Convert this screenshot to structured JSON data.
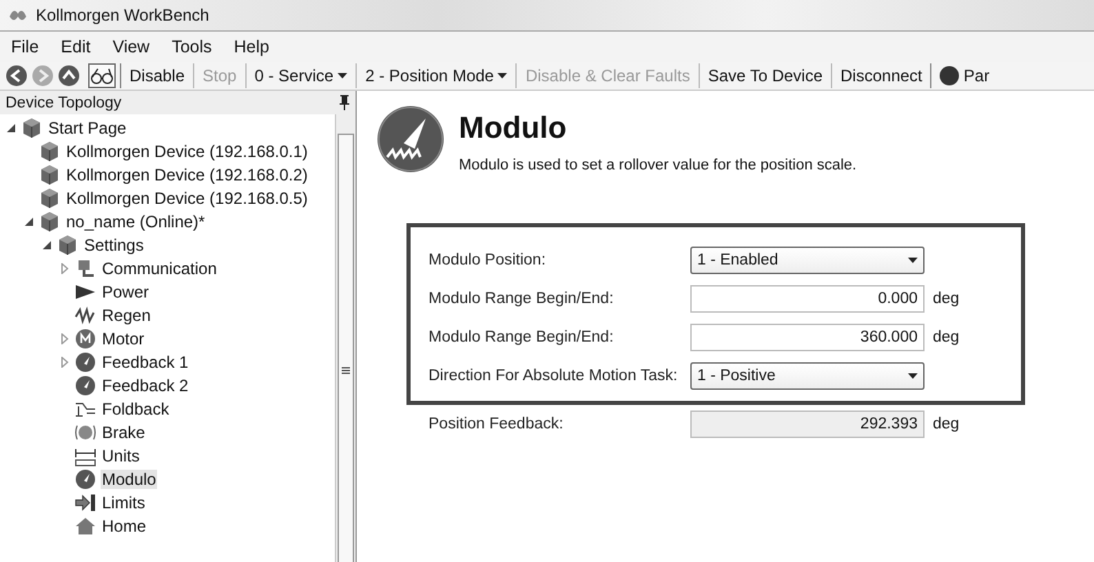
{
  "window": {
    "title": "Kollmorgen WorkBench"
  },
  "menu": [
    "File",
    "Edit",
    "View",
    "Tools",
    "Help"
  ],
  "toolbar": [
    {
      "kind": "button",
      "label": "Disable",
      "disabled": false
    },
    {
      "kind": "button",
      "label": "Stop",
      "disabled": true
    },
    {
      "kind": "dropdown",
      "label": "0 - Service",
      "disabled": false
    },
    {
      "kind": "dropdown",
      "label": "2 - Position Mode",
      "disabled": false
    },
    {
      "kind": "button",
      "label": "Disable & Clear Faults",
      "disabled": true
    },
    {
      "kind": "button",
      "label": "Save To Device",
      "disabled": false
    },
    {
      "kind": "button",
      "label": "Disconnect",
      "disabled": false
    },
    {
      "kind": "status",
      "label": "Par",
      "disabled": false
    }
  ],
  "sidebar": {
    "title": "Device Topology",
    "items": [
      {
        "label": "Start Page",
        "kind": "start",
        "expanded": true,
        "selected": false,
        "children": [
          {
            "label": "Kollmorgen Device (192.168.0.1)",
            "kind": "device",
            "selected": false
          },
          {
            "label": "Kollmorgen Device (192.168.0.2)",
            "kind": "device",
            "selected": false
          },
          {
            "label": "Kollmorgen Device (192.168.0.5)",
            "kind": "device",
            "selected": false
          },
          {
            "label": "no_name (Online)*",
            "kind": "device",
            "expanded": true,
            "selected": false,
            "children": [
              {
                "label": "Settings",
                "kind": "settings",
                "expanded": true,
                "selected": false,
                "children": [
                  {
                    "label": "Communication",
                    "kind": "communication",
                    "expanded": false,
                    "selected": false
                  },
                  {
                    "label": "Power",
                    "kind": "power",
                    "selected": false
                  },
                  {
                    "label": "Regen",
                    "kind": "regen",
                    "selected": false
                  },
                  {
                    "label": "Motor",
                    "kind": "motor",
                    "expanded": false,
                    "selected": false
                  },
                  {
                    "label": "Feedback 1",
                    "kind": "feedback",
                    "expanded": false,
                    "selected": false
                  },
                  {
                    "label": "Feedback 2",
                    "kind": "feedback",
                    "selected": false
                  },
                  {
                    "label": "Foldback",
                    "kind": "foldback",
                    "selected": false
                  },
                  {
                    "label": "Brake",
                    "kind": "brake",
                    "selected": false
                  },
                  {
                    "label": "Units",
                    "kind": "units",
                    "selected": false
                  },
                  {
                    "label": "Modulo",
                    "kind": "modulo",
                    "selected": true
                  },
                  {
                    "label": "Limits",
                    "kind": "limits",
                    "selected": false
                  },
                  {
                    "label": "Home",
                    "kind": "home",
                    "selected": false
                  }
                ]
              }
            ]
          }
        ]
      }
    ]
  },
  "page": {
    "title": "Modulo",
    "description": "Modulo is used to set a rollover value for the position scale.",
    "highlighted_fields": [
      {
        "kind": "select",
        "label": "Modulo Position:",
        "value": "1 - Enabled"
      },
      {
        "kind": "number",
        "label": "Modulo Range Begin/End:",
        "value": "0.000",
        "unit": "deg"
      },
      {
        "kind": "number",
        "label": "Modulo Range Begin/End:",
        "value": "360.000",
        "unit": "deg"
      },
      {
        "kind": "select",
        "label": "Direction For Absolute Motion Task:",
        "value": "1 - Positive"
      }
    ],
    "other_fields": [
      {
        "kind": "readonly",
        "label": "Position Feedback:",
        "value": "292.393",
        "unit": "deg"
      }
    ]
  }
}
